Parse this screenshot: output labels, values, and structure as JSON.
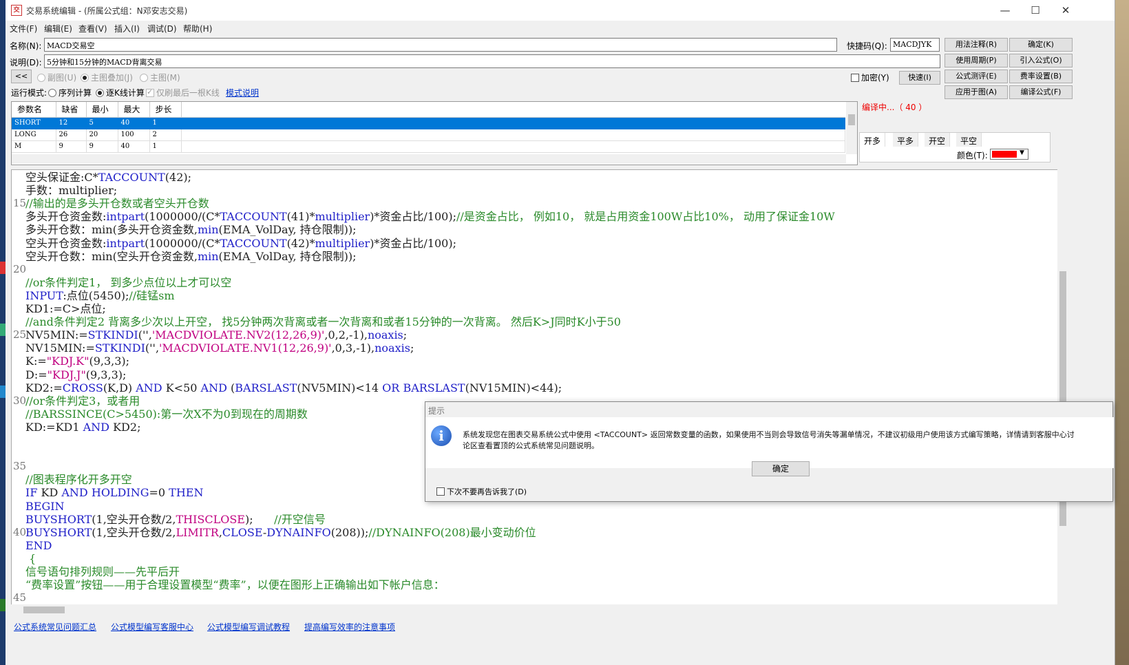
{
  "window": {
    "title": "交易系统编辑 - (所属公式组：N邓安志交易)",
    "icon_text": "交",
    "minimize": "—",
    "maximize": "☐",
    "close": "✕"
  },
  "menu": [
    "文件(F)",
    "编辑(E)",
    "查看(V)",
    "插入(I)",
    "调试(D)",
    "帮助(H)"
  ],
  "form": {
    "name_label": "名称(N):",
    "name_value": "MACD交易空",
    "desc_label": "说明(D):",
    "desc_value": "5分钟和15分钟的MACD背离交易",
    "shortcut_label": "快捷码(Q):",
    "shortcut_value": "MACDJYK",
    "collapse_btn": "<<",
    "radio_subchart": "副图(U)",
    "radio_overlay": "主图叠加(J)",
    "radio_main": "主图(M)",
    "encrypt_label": "加密(Y)",
    "quick_btn": "快速(I)",
    "run_mode_label": "运行模式:",
    "radio_seq": "序列计算",
    "radio_tick": "逐K线计算",
    "only_last_label": "仅刷最后一根K线",
    "mode_help_link": "模式说明"
  },
  "buttons": {
    "usage_note": "用法注释(R)",
    "confirm": "确定(K)",
    "use_period": "使用周期(P)",
    "import_formula": "引入公式(O)",
    "formula_test": "公式测评(E)",
    "fee_settings": "费率设置(B)",
    "apply_to_chart": "应用于图(A)",
    "compile": "编译公式(F)"
  },
  "status": {
    "compiling": "编译中...（ 40 ）"
  },
  "params": {
    "headers": [
      "参数名",
      "缺省",
      "最小",
      "最大",
      "步长"
    ],
    "rows": [
      [
        "SHORT",
        "12",
        "5",
        "40",
        "1"
      ],
      [
        "LONG",
        "26",
        "20",
        "100",
        "2"
      ],
      [
        "M",
        "9",
        "9",
        "40",
        "1"
      ]
    ],
    "selected_row": 0
  },
  "signal_tabs": {
    "tabs": [
      "开多",
      "平多",
      "开空",
      "平空"
    ],
    "active": 0,
    "color_label": "颜色(T):",
    "color_value": "#ff0000"
  },
  "editor": {
    "lines": [
      {
        "n": "",
        "segs": [
          [
            "空头保证金:",
            "dark"
          ],
          [
            "C",
            "dark"
          ],
          [
            "*",
            "dark"
          ],
          [
            "TACCOUNT",
            "blue"
          ],
          [
            "(42);",
            "dark"
          ]
        ]
      },
      {
        "n": "",
        "segs": [
          [
            "手数：multiplier;",
            "dark"
          ]
        ]
      },
      {
        "n": "15",
        "segs": [
          [
            "//输出的是多头开仓数或者空头开仓数",
            "green"
          ]
        ]
      },
      {
        "n": "",
        "segs": [
          [
            "多头开仓资金数:",
            "dark"
          ],
          [
            "intpart",
            "blue"
          ],
          [
            "(1000000/(C*",
            "dark"
          ],
          [
            "TACCOUNT",
            "blue"
          ],
          [
            "(41)*",
            "dark"
          ],
          [
            "multiplier",
            "blue"
          ],
          [
            ")*资金占比/100);",
            "dark"
          ],
          [
            "//是资金占比， 例如10， 就是占用资金100W占比10%， 动用了保证金10W",
            "green"
          ]
        ]
      },
      {
        "n": "",
        "segs": [
          [
            "多头开仓数：min(多头开仓资金数,",
            "dark"
          ],
          [
            "min",
            "blue"
          ],
          [
            "(EMA_VolDay, 持仓限制));",
            "dark"
          ]
        ]
      },
      {
        "n": "",
        "segs": [
          [
            "空头开仓资金数:",
            "dark"
          ],
          [
            "intpart",
            "blue"
          ],
          [
            "(1000000/(C*",
            "dark"
          ],
          [
            "TACCOUNT",
            "blue"
          ],
          [
            "(42)*",
            "dark"
          ],
          [
            "multiplier",
            "blue"
          ],
          [
            ")*资金占比/100);",
            "dark"
          ]
        ]
      },
      {
        "n": "",
        "segs": [
          [
            "空头开仓数：min(空头开仓资金数,",
            "dark"
          ],
          [
            "min",
            "blue"
          ],
          [
            "(EMA_VolDay, 持仓限制));",
            "dark"
          ]
        ]
      },
      {
        "n": "20",
        "segs": []
      },
      {
        "n": "",
        "segs": [
          [
            "//or条件判定1， 到多少点位以上才可以空",
            "green"
          ]
        ]
      },
      {
        "n": "",
        "segs": [
          [
            "INPUT",
            "blue"
          ],
          [
            ":点位(5450);",
            "dark"
          ],
          [
            "//硅锰sm",
            "green"
          ]
        ]
      },
      {
        "n": "",
        "segs": [
          [
            "KD1:=C>点位;",
            "dark"
          ]
        ]
      },
      {
        "n": "",
        "segs": [
          [
            "//and条件判定2 背离多少次以上开空， 找5分钟两次背离或者一次背离和或者15分钟的一次背离。 然后K>J同时K小于50",
            "green"
          ]
        ]
      },
      {
        "n": "25",
        "segs": [
          [
            "NV5MIN:=",
            "dark"
          ],
          [
            "STKINDI",
            "blue"
          ],
          [
            "('',",
            "dark"
          ],
          [
            "'MACDVIOLATE.NV2(12,26,9)'",
            "mag"
          ],
          [
            ",0,2,-1),",
            "dark"
          ],
          [
            "noaxis",
            "blue"
          ],
          [
            ";",
            "dark"
          ]
        ]
      },
      {
        "n": "",
        "segs": [
          [
            "NV15MIN:=",
            "dark"
          ],
          [
            "STKINDI",
            "blue"
          ],
          [
            "('',",
            "dark"
          ],
          [
            "'MACDVIOLATE.NV1(12,26,9)'",
            "mag"
          ],
          [
            ",0,3,-1),",
            "dark"
          ],
          [
            "noaxis",
            "blue"
          ],
          [
            ";",
            "dark"
          ]
        ]
      },
      {
        "n": "",
        "segs": [
          [
            "K:=",
            "dark"
          ],
          [
            "\"KDJ.K\"",
            "mag"
          ],
          [
            "(9,3,3);",
            "dark"
          ]
        ]
      },
      {
        "n": "",
        "segs": [
          [
            "D:=",
            "dark"
          ],
          [
            "\"KDJ.J\"",
            "mag"
          ],
          [
            "(9,3,3);",
            "dark"
          ]
        ]
      },
      {
        "n": "",
        "segs": [
          [
            "KD2:=",
            "dark"
          ],
          [
            "CROSS",
            "blue"
          ],
          [
            "(K,D) ",
            "dark"
          ],
          [
            "AND",
            "blue"
          ],
          [
            " K<50 ",
            "dark"
          ],
          [
            "AND",
            "blue"
          ],
          [
            " (",
            "dark"
          ],
          [
            "BARSLAST",
            "blue"
          ],
          [
            "(NV5MIN)<14 ",
            "dark"
          ],
          [
            "OR",
            "blue"
          ],
          [
            " ",
            "dark"
          ],
          [
            "BARSLAST",
            "blue"
          ],
          [
            "(NV15MIN)<44);",
            "dark"
          ]
        ]
      },
      {
        "n": "30",
        "segs": [
          [
            "//or条件判定3，或者用",
            "green"
          ]
        ]
      },
      {
        "n": "",
        "segs": [
          [
            "//BARSSINCE(C>5450):第一次X不为0到现在的周期数",
            "green"
          ]
        ]
      },
      {
        "n": "",
        "segs": [
          [
            "KD:=KD1 ",
            "dark"
          ],
          [
            "AND",
            "blue"
          ],
          [
            " KD2;",
            "dark"
          ]
        ]
      },
      {
        "n": "",
        "segs": []
      },
      {
        "n": "",
        "segs": []
      },
      {
        "n": "35",
        "segs": []
      },
      {
        "n": "",
        "segs": [
          [
            "//图表程序化开多开空",
            "green"
          ]
        ]
      },
      {
        "n": "",
        "segs": [
          [
            "IF",
            "blue"
          ],
          [
            " KD ",
            "dark"
          ],
          [
            "AND",
            "blue"
          ],
          [
            " ",
            "dark"
          ],
          [
            "HOLDING",
            "blue"
          ],
          [
            "=0 ",
            "dark"
          ],
          [
            "THEN",
            "blue"
          ]
        ]
      },
      {
        "n": "",
        "segs": [
          [
            "BEGIN",
            "blue"
          ]
        ]
      },
      {
        "n": "",
        "segs": [
          [
            "BUYSHORT",
            "blue"
          ],
          [
            "(1,空头开仓数/2,",
            "dark"
          ],
          [
            "THISCLOSE",
            "mag"
          ],
          [
            ");      ",
            "dark"
          ],
          [
            "//开空信号",
            "green"
          ]
        ]
      },
      {
        "n": "40",
        "segs": [
          [
            "BUYSHORT",
            "blue"
          ],
          [
            "(1,空头开仓数/2,",
            "dark"
          ],
          [
            "LIMITR",
            "mag"
          ],
          [
            ",",
            "dark"
          ],
          [
            "CLOSE",
            "blue"
          ],
          [
            "-",
            "dark"
          ],
          [
            "DYNAINFO",
            "blue"
          ],
          [
            "(208));",
            "dark"
          ],
          [
            "//DYNAINFO(208)最小变动价位",
            "green"
          ]
        ]
      },
      {
        "n": "",
        "segs": [
          [
            "END",
            "blue"
          ]
        ]
      },
      {
        "n": "",
        "segs": [
          [
            " {",
            "green"
          ]
        ]
      },
      {
        "n": "",
        "segs": [
          [
            "信号语句排列规则——先平后开",
            "green"
          ]
        ]
      },
      {
        "n": "",
        "segs": [
          [
            "“费率设置”按钮——用于合理设置模型“费率”，以便在图形上正确输出如下帐户信息：",
            "green"
          ]
        ]
      },
      {
        "n": "45",
        "segs": []
      }
    ]
  },
  "footer": {
    "links": [
      "公式系统常见问题汇总",
      "公式模型编写客服中心",
      "公式模型编写调试教程",
      "提高编写效率的注意事项"
    ]
  },
  "dialog": {
    "title": "提示",
    "message": "系统发现您在图表交易系统公式中使用 <TACCOUNT> 返回常数变量的函数，如果使用不当则会导致信号消失等漏单情况，不建议初级用户使用该方式编写策略，详情请到客服中心讨论区查看置顶的公式系统常见问题说明。",
    "ok": "确定",
    "dont_show": "下次不要再告诉我了(D)"
  }
}
